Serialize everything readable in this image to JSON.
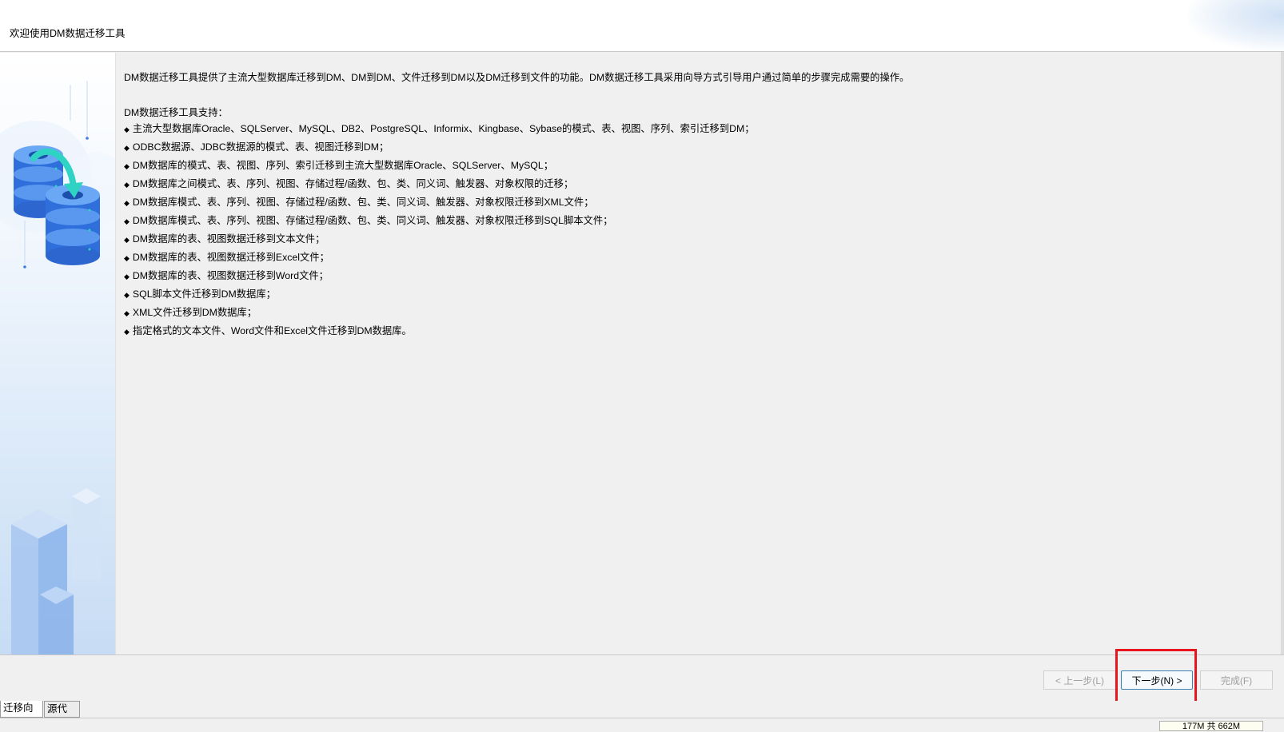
{
  "header": {
    "title": "欢迎使用DM数据迁移工具"
  },
  "content": {
    "intro": "DM数据迁移工具提供了主流大型数据库迁移到DM、DM到DM、文件迁移到DM以及DM迁移到文件的功能。DM数据迁移工具采用向导方式引导用户通过简单的步骤完成需要的操作。",
    "support_title": "DM数据迁移工具支持：",
    "bullet": "◆",
    "features": [
      "主流大型数据库Oracle、SQLServer、MySQL、DB2、PostgreSQL、Informix、Kingbase、Sybase的模式、表、视图、序列、索引迁移到DM；",
      "ODBC数据源、JDBC数据源的模式、表、视图迁移到DM；",
      "DM数据库的模式、表、视图、序列、索引迁移到主流大型数据库Oracle、SQLServer、MySQL；",
      "DM数据库之间模式、表、序列、视图、存储过程/函数、包、类、同义词、触发器、对象权限的迁移；",
      "DM数据库模式、表、序列、视图、存储过程/函数、包、类、同义词、触发器、对象权限迁移到XML文件；",
      "DM数据库模式、表、序列、视图、存储过程/函数、包、类、同义词、触发器、对象权限迁移到SQL脚本文件；",
      "DM数据库的表、视图数据迁移到文本文件；",
      "DM数据库的表、视图数据迁移到Excel文件；",
      "DM数据库的表、视图数据迁移到Word文件；",
      "SQL脚本文件迁移到DM数据库；",
      "XML文件迁移到DM数据库；",
      "指定格式的文本文件、Word文件和Excel文件迁移到DM数据库。"
    ]
  },
  "buttons": {
    "prev": "< 上一步(L)",
    "next": "下一步(N) >",
    "finish": "完成(F)"
  },
  "tabs": [
    "迁移向导",
    "源代码"
  ],
  "status": {
    "memory": "177M 共 662M"
  },
  "colors": {
    "highlight": "#e8141e",
    "db_blue": "#3b7de3",
    "arrow_teal": "#2fd3c4"
  }
}
